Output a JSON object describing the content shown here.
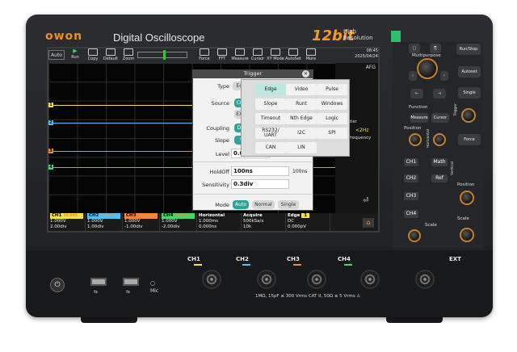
{
  "brand": {
    "logo": "owon",
    "model_title": "Digital Oscilloscope",
    "bit_badge": "12bit",
    "bit_sub_1": "High",
    "bit_sub_2": "Resolution"
  },
  "toolbar": {
    "auto": "Auto",
    "buttons": [
      "Run",
      "Copy",
      "Default",
      "Zoom"
    ],
    "right_buttons": [
      "Force",
      "FFT",
      "Measure",
      "Cursor",
      "XY Mode",
      "AutoSet",
      "More"
    ]
  },
  "clock": {
    "time": "08:45",
    "date": "2025/04/24"
  },
  "side_panel": {
    "afg": "AFG",
    "counter": "Counter",
    "counter_value": "<2Hz",
    "frequency": "Frequency"
  },
  "channels": [
    {
      "id": "1",
      "name": "CH1",
      "probe": "10.00X",
      "volts": "1.000V",
      "scale": "2.00div",
      "color": "#f5e14a"
    },
    {
      "id": "2",
      "name": "CH2",
      "probe": "10.00X",
      "volts": "1.000V",
      "scale": "1.00div",
      "color": "#4ec2f7"
    },
    {
      "id": "3",
      "name": "CH3",
      "probe": "10.00X",
      "volts": "1.000V",
      "scale": "-1.00div",
      "color": "#f0873b"
    },
    {
      "id": "4",
      "name": "CH4",
      "probe": "10.00X",
      "volts": "1.000V",
      "scale": "-2.00div",
      "color": "#49d36a"
    }
  ],
  "status": {
    "horizontal": {
      "label": "Horizontal",
      "v1": "1.000ms",
      "v2": "0.000ns"
    },
    "acquire": {
      "label": "Acquire",
      "v1": "500kSa/s",
      "v2": "10k"
    },
    "edge": {
      "label": "Edge",
      "ch": "1",
      "v1": "DC",
      "v2": "0.000pV"
    }
  },
  "trigger_dialog": {
    "title": "Trigger",
    "type_label": "Type",
    "type_value": "Edge",
    "source_label": "Source",
    "source_value": "CH1",
    "source_ext": "EXT/",
    "coupling_label": "Coupling",
    "coupling_value": "DC",
    "slope_label": "Slope",
    "slope_value": "↑",
    "level_label": "Level",
    "level_value": "0.000p",
    "holdoff_label": "HoldOff",
    "holdoff_value": "100ns",
    "holdoff_unit": "100ns",
    "sensitivity_label": "Sensitivity",
    "sensitivity_value": "0.3div",
    "mode_label": "Mode",
    "mode_options": [
      "Auto",
      "Normal",
      "Single"
    ],
    "mode_selected": "Auto"
  },
  "trigger_types": [
    [
      "Edge",
      "Video",
      "Pulse"
    ],
    [
      "Slope",
      "Runt",
      "Windows"
    ],
    [
      "Timeout",
      "Nth Edge",
      "Logic"
    ],
    [
      "RS232/ UART",
      "I2C",
      "SPI"
    ],
    [
      "CAN",
      "LIN",
      ""
    ]
  ],
  "controls": {
    "run_stop": "Run/Stop",
    "multipurpose": "Multipurpose",
    "autoset": "Autoset",
    "single": "Single",
    "function": "Function",
    "measure": "Measure",
    "cursor": "Cursor",
    "trigger": "Trigger",
    "position": "Position",
    "force": "Force",
    "math": "Math",
    "ref": "Ref",
    "vertical": "Vertical",
    "horizontal": "Horizontal",
    "scale": "Scale",
    "ch_buttons": [
      "CH1",
      "CH2",
      "CH3",
      "CH4"
    ]
  },
  "front": {
    "channel_labels": [
      "CH1",
      "CH2",
      "CH3",
      "CH4"
    ],
    "ext": "EXT",
    "mic": "Mic",
    "spec": "1MΩ, 15pF ≤ 300 Vrms CAT II, 50Ω ≤ 5 Vrms ⚠"
  }
}
